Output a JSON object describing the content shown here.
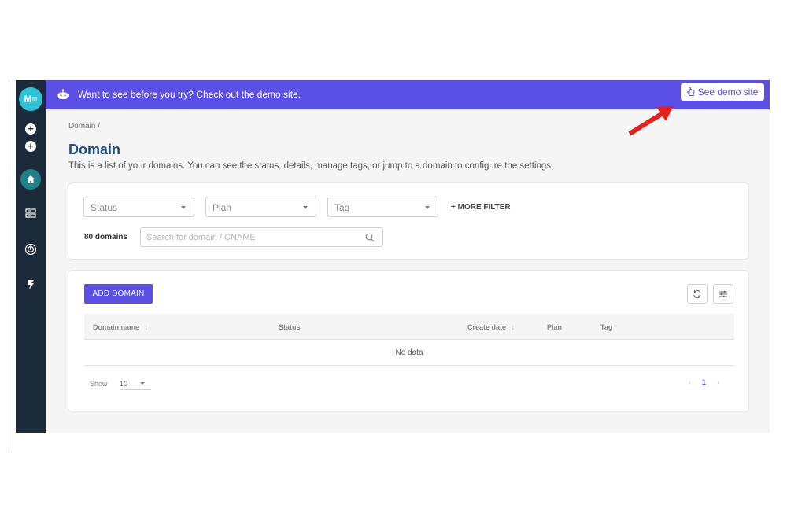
{
  "app": {
    "logo_text": "M≡",
    "brand_color": "#5a50e6",
    "sidebar_color": "#1c2b3a"
  },
  "sidebar": {
    "items": [
      {
        "icon": "add-circle-icon"
      },
      {
        "icon": "add-circle-icon"
      },
      {
        "icon": "home-icon",
        "active": true
      },
      {
        "icon": "server-icon"
      },
      {
        "icon": "radar-icon"
      },
      {
        "icon": "bolt-icon"
      }
    ]
  },
  "banner": {
    "icon": "robot-icon",
    "text": "Want to see before you try? Check out the demo site.",
    "button_icon": "pointer-hand-icon",
    "button_label": "See demo site"
  },
  "breadcrumb": "Domain /",
  "page": {
    "title": "Domain",
    "description": "This is a list of your domains. You can see the status, details, manage tags, or jump to a domain to configure the settings."
  },
  "filters": {
    "status_placeholder": "Status",
    "plan_placeholder": "Plan",
    "tag_placeholder": "Tag",
    "more_filter_label": "+ MORE FILTER",
    "domain_count": "80 domains",
    "search_placeholder": "Search for domain / CNAME"
  },
  "table": {
    "add_button_label": "ADD DOMAIN",
    "columns": {
      "domain_name": "Domain name",
      "status": "Status",
      "create_date": "Create date",
      "plan": "Plan",
      "tag": "Tag"
    },
    "empty_text": "No data",
    "show_label": "Show",
    "page_size": "10",
    "current_page": "1"
  },
  "annotation": {
    "arrow_color": "#e8201c"
  }
}
